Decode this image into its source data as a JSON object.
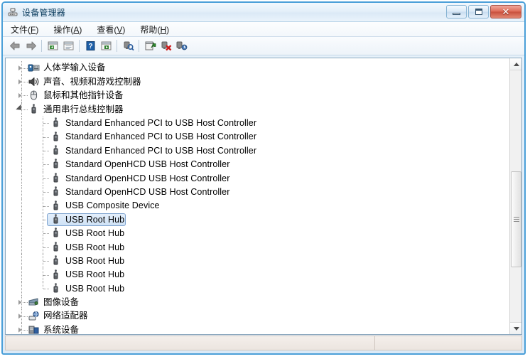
{
  "window": {
    "title": "设备管理器",
    "title_icon": "device-manager-icon",
    "controls": {
      "minimize": "最小化",
      "maximize": "最大化",
      "close": "关闭",
      "minimize_glyph": "—",
      "maximize_glyph": "□",
      "close_glyph": "✕"
    },
    "accent_border": "#4a9fd8",
    "close_button_color": "#c84f3c"
  },
  "menubar": {
    "items": [
      {
        "label": "文件",
        "accel": "F",
        "name": "menu-file"
      },
      {
        "label": "操作",
        "accel": "A",
        "name": "menu-action"
      },
      {
        "label": "查看",
        "accel": "V",
        "name": "menu-view"
      },
      {
        "label": "帮助",
        "accel": "H",
        "name": "menu-help"
      }
    ]
  },
  "toolbar": {
    "buttons": [
      {
        "name": "back-button",
        "icon": "arrow-left-icon",
        "glyph": "⬅"
      },
      {
        "name": "forward-button",
        "icon": "arrow-right-icon",
        "glyph": "➡"
      },
      {
        "name": "separator-1",
        "icon": "separator"
      },
      {
        "name": "show-hidden-devices-button",
        "icon": "window-list-icon"
      },
      {
        "name": "properties-button",
        "icon": "properties-icon"
      },
      {
        "name": "separator-2",
        "icon": "separator"
      },
      {
        "name": "help-button",
        "icon": "help-question-icon"
      },
      {
        "name": "console-button",
        "icon": "console-play-icon"
      },
      {
        "name": "separator-3",
        "icon": "separator"
      },
      {
        "name": "scan-hardware-changes-button",
        "icon": "scan-hardware-icon"
      },
      {
        "name": "separator-4",
        "icon": "separator"
      },
      {
        "name": "update-driver-button",
        "icon": "update-driver-icon"
      },
      {
        "name": "disable-device-button",
        "icon": "disable-device-icon"
      },
      {
        "name": "uninstall-device-button",
        "icon": "uninstall-device-icon"
      }
    ]
  },
  "tree": {
    "nodes": [
      {
        "label": "人体学输入设备",
        "level": 0,
        "state": "collapsed",
        "icon": "hid-device-icon",
        "lang": "cn",
        "selected": false
      },
      {
        "label": "声音、视频和游戏控制器",
        "level": 0,
        "state": "collapsed",
        "icon": "sound-device-icon",
        "lang": "cn",
        "selected": false
      },
      {
        "label": "鼠标和其他指针设备",
        "level": 0,
        "state": "collapsed",
        "icon": "mouse-device-icon",
        "lang": "cn",
        "selected": false
      },
      {
        "label": "通用串行总线控制器",
        "level": 0,
        "state": "expanded",
        "icon": "usb-controller-icon",
        "lang": "cn",
        "selected": false
      },
      {
        "label": "Standard Enhanced PCI to USB Host Controller",
        "level": 1,
        "state": "leaf",
        "icon": "usb-device-icon",
        "lang": "en",
        "selected": false
      },
      {
        "label": "Standard Enhanced PCI to USB Host Controller",
        "level": 1,
        "state": "leaf",
        "icon": "usb-device-icon",
        "lang": "en",
        "selected": false
      },
      {
        "label": "Standard Enhanced PCI to USB Host Controller",
        "level": 1,
        "state": "leaf",
        "icon": "usb-device-icon",
        "lang": "en",
        "selected": false
      },
      {
        "label": "Standard OpenHCD USB Host Controller",
        "level": 1,
        "state": "leaf",
        "icon": "usb-device-icon",
        "lang": "en",
        "selected": false
      },
      {
        "label": "Standard OpenHCD USB Host Controller",
        "level": 1,
        "state": "leaf",
        "icon": "usb-device-icon",
        "lang": "en",
        "selected": false
      },
      {
        "label": "Standard OpenHCD USB Host Controller",
        "level": 1,
        "state": "leaf",
        "icon": "usb-device-icon",
        "lang": "en",
        "selected": false
      },
      {
        "label": "USB Composite Device",
        "level": 1,
        "state": "leaf",
        "icon": "usb-device-icon",
        "lang": "en",
        "selected": false
      },
      {
        "label": "USB Root Hub",
        "level": 1,
        "state": "leaf",
        "icon": "usb-device-icon",
        "lang": "en",
        "selected": true
      },
      {
        "label": "USB Root Hub",
        "level": 1,
        "state": "leaf",
        "icon": "usb-device-icon",
        "lang": "en",
        "selected": false
      },
      {
        "label": "USB Root Hub",
        "level": 1,
        "state": "leaf",
        "icon": "usb-device-icon",
        "lang": "en",
        "selected": false
      },
      {
        "label": "USB Root Hub",
        "level": 1,
        "state": "leaf",
        "icon": "usb-device-icon",
        "lang": "en",
        "selected": false
      },
      {
        "label": "USB Root Hub",
        "level": 1,
        "state": "leaf",
        "icon": "usb-device-icon",
        "lang": "en",
        "selected": false
      },
      {
        "label": "USB Root Hub",
        "level": 1,
        "state": "leaf",
        "icon": "usb-device-icon",
        "lang": "en",
        "selected": false
      },
      {
        "label": "图像设备",
        "level": 0,
        "state": "collapsed",
        "icon": "imaging-device-icon",
        "lang": "cn",
        "selected": false
      },
      {
        "label": "网络适配器",
        "level": 0,
        "state": "collapsed",
        "icon": "network-adapter-icon",
        "lang": "cn",
        "selected": false
      },
      {
        "label": "系统设备",
        "level": 0,
        "state": "collapsed",
        "icon": "system-device-icon",
        "lang": "cn",
        "selected": false
      }
    ],
    "selected_index": 11,
    "selection_bg": "#cfe2f6",
    "selection_border": "#7da2ce"
  },
  "scrollbar": {
    "orientation": "vertical",
    "up_arrow": "▲",
    "down_arrow": "▼",
    "thumb_top_pct": 40,
    "thumb_height_pct": 38
  },
  "statusbar": {
    "left_text": "",
    "right_text": ""
  }
}
